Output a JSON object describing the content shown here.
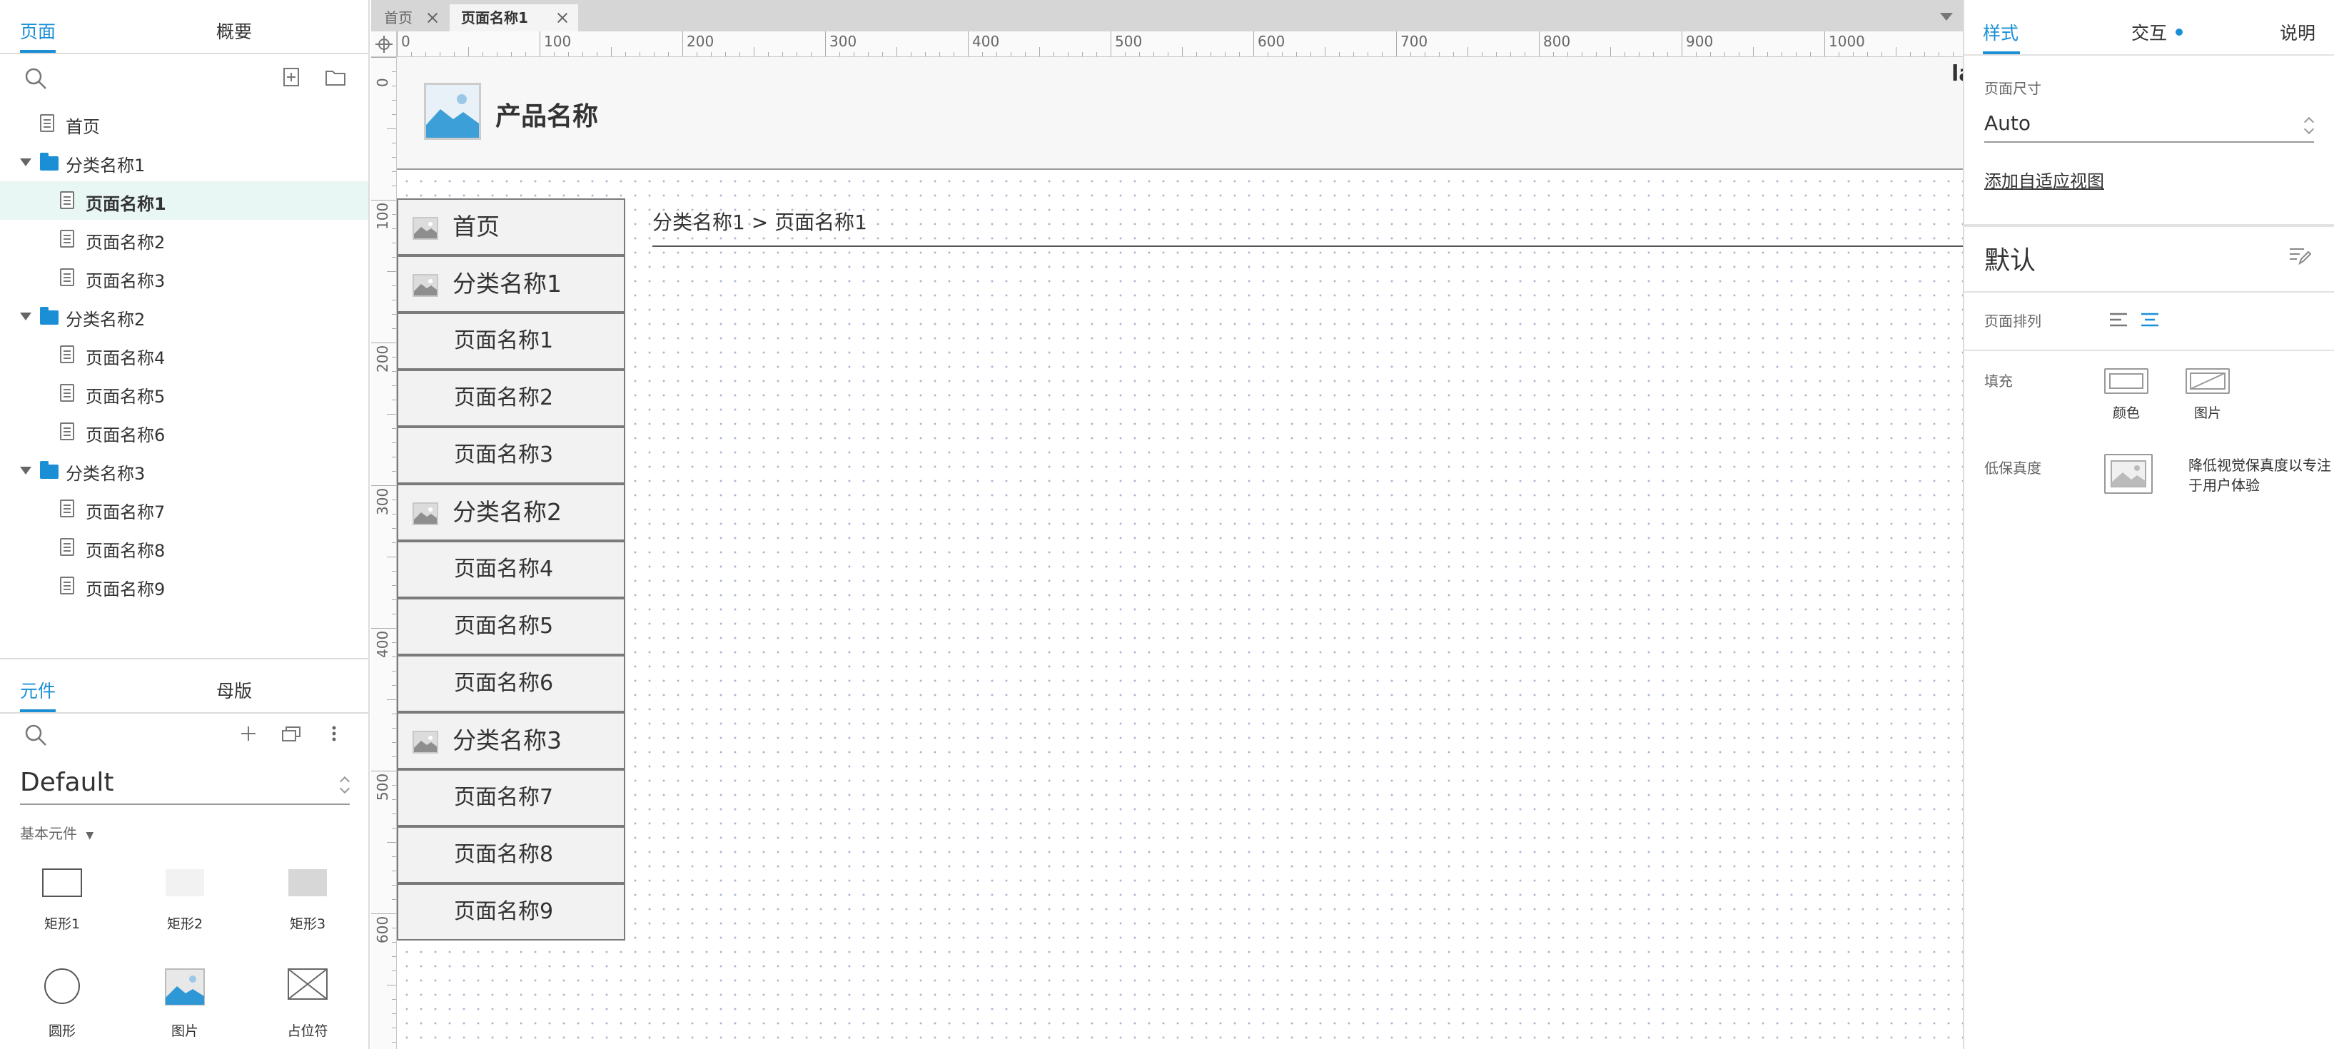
{
  "left_panel": {
    "tabs": {
      "pages": "页面",
      "outline": "概要"
    },
    "tree": [
      {
        "label": "首页",
        "type": "page",
        "level": 0
      },
      {
        "label": "分类名称1",
        "type": "folder",
        "level": 0
      },
      {
        "label": "页面名称1",
        "type": "page",
        "level": 1,
        "selected": true
      },
      {
        "label": "页面名称2",
        "type": "page",
        "level": 1
      },
      {
        "label": "页面名称3",
        "type": "page",
        "level": 1
      },
      {
        "label": "分类名称2",
        "type": "folder",
        "level": 0
      },
      {
        "label": "页面名称4",
        "type": "page",
        "level": 1
      },
      {
        "label": "页面名称5",
        "type": "page",
        "level": 1
      },
      {
        "label": "页面名称6",
        "type": "page",
        "level": 1
      },
      {
        "label": "分类名称3",
        "type": "folder",
        "level": 0
      },
      {
        "label": "页面名称7",
        "type": "page",
        "level": 1
      },
      {
        "label": "页面名称8",
        "type": "page",
        "level": 1
      },
      {
        "label": "页面名称9",
        "type": "page",
        "level": 1
      }
    ],
    "library_tabs": {
      "widgets": "元件",
      "masters": "母版"
    },
    "library_select": "Default",
    "library_section": "基本元件",
    "widgets": [
      {
        "label": "矩形1",
        "icon": "rectangle-outline-icon"
      },
      {
        "label": "矩形2",
        "icon": "rectangle-light-icon"
      },
      {
        "label": "矩形3",
        "icon": "rectangle-gray-icon"
      },
      {
        "label": "圆形",
        "icon": "circle-icon"
      },
      {
        "label": "图片",
        "icon": "image-icon"
      },
      {
        "label": "占位符",
        "icon": "placeholder-icon"
      }
    ]
  },
  "doc_tabs": [
    {
      "label": "首页",
      "active": false
    },
    {
      "label": "页面名称1",
      "active": true
    }
  ],
  "ruler": {
    "h_labels": [
      "0",
      "100",
      "200",
      "300",
      "400",
      "500",
      "600",
      "700",
      "800",
      "900",
      "1000"
    ],
    "v_labels": [
      "0",
      "100",
      "200",
      "300",
      "400",
      "500",
      "600"
    ]
  },
  "canvas": {
    "product_name": "产品名称",
    "header_cut_text": "la",
    "nav": [
      {
        "label": "首页",
        "type": "category"
      },
      {
        "label": "分类名称1",
        "type": "category"
      },
      {
        "label": "页面名称1",
        "type": "page"
      },
      {
        "label": "页面名称2",
        "type": "page"
      },
      {
        "label": "页面名称3",
        "type": "page"
      },
      {
        "label": "分类名称2",
        "type": "category"
      },
      {
        "label": "页面名称4",
        "type": "page"
      },
      {
        "label": "页面名称5",
        "type": "page"
      },
      {
        "label": "页面名称6",
        "type": "page"
      },
      {
        "label": "分类名称3",
        "type": "category"
      },
      {
        "label": "页面名称7",
        "type": "page"
      },
      {
        "label": "页面名称8",
        "type": "page"
      },
      {
        "label": "页面名称9",
        "type": "page"
      }
    ],
    "breadcrumb": "分类名称1 > 页面名称1"
  },
  "right_panel": {
    "tabs": {
      "style": "样式",
      "interaction": "交互",
      "notes": "说明"
    },
    "page_size_label": "页面尺寸",
    "page_size_value": "Auto",
    "adaptive_link": "添加自适应视图",
    "style_name": "默认",
    "page_align_label": "页面排列",
    "fill_label": "填充",
    "fill_color": "颜色",
    "fill_image": "图片",
    "low_fidelity_label": "低保真度",
    "low_fidelity_desc_line1": "降低视觉保真度以专注",
    "low_fidelity_desc_line2": "于用户体验"
  },
  "colors": {
    "accent": "#1a8fd6",
    "selected_row": "#e8f6f4",
    "grid_dot": "#a9b6cc"
  }
}
